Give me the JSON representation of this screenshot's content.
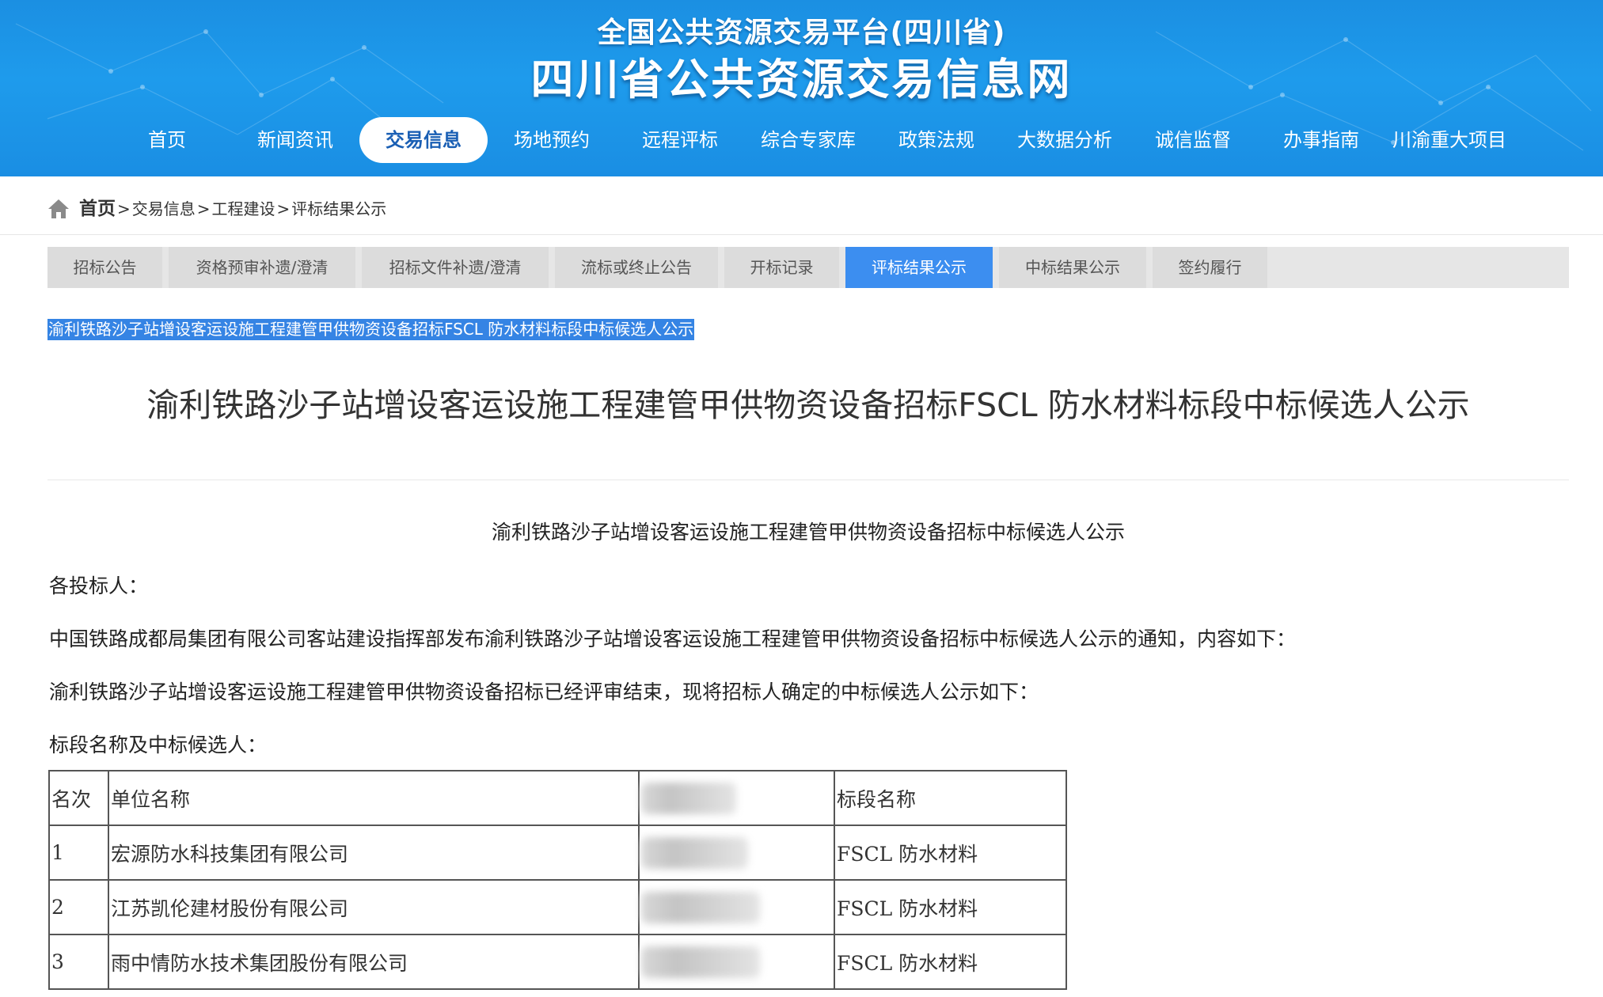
{
  "header": {
    "subtitle": "全国公共资源交易平台(四川省)",
    "title": "四川省公共资源交易信息网"
  },
  "nav": {
    "items": [
      {
        "label": "首页"
      },
      {
        "label": "新闻资讯"
      },
      {
        "label": "交易信息",
        "active": true
      },
      {
        "label": "场地预约"
      },
      {
        "label": "远程评标"
      },
      {
        "label": "综合专家库"
      },
      {
        "label": "政策法规"
      },
      {
        "label": "大数据分析"
      },
      {
        "label": "诚信监督"
      },
      {
        "label": "办事指南"
      },
      {
        "label": "川渝重大项目"
      }
    ]
  },
  "breadcrumb": {
    "home": "首页",
    "items": [
      "交易信息",
      "工程建设",
      "评标结果公示"
    ],
    "separator": ">"
  },
  "subtabs": {
    "items": [
      {
        "label": "招标公告"
      },
      {
        "label": "资格预审补遗/澄清"
      },
      {
        "label": "招标文件补遗/澄清"
      },
      {
        "label": "流标或终止公告"
      },
      {
        "label": "开标记录"
      },
      {
        "label": "评标结果公示",
        "active": true
      },
      {
        "label": "中标结果公示"
      },
      {
        "label": "签约履行"
      }
    ]
  },
  "article": {
    "selected_text": "渝利铁路沙子站增设客运设施工程建管甲供物资设备招标FSCL 防水材料标段中标候选人公示",
    "title": "渝利铁路沙子站增设客运设施工程建管甲供物资设备招标FSCL 防水材料标段中标候选人公示",
    "doc_heading": "渝利铁路沙子站增设客运设施工程建管甲供物资设备招标中标候选人公示",
    "paragraphs": [
      "各投标人：",
      "中国铁路成都局集团有限公司客站建设指挥部发布渝利铁路沙子站增设客运设施工程建管甲供物资设备招标中标候选人公示的通知，内容如下：",
      "渝利铁路沙子站增设客运设施工程建管甲供物资设备招标已经评审结束，现将招标人确定的中标候选人公示如下：",
      "标段名称及中标候选人："
    ]
  },
  "table": {
    "headers": [
      "名次",
      "单位名称",
      "",
      "标段名称"
    ],
    "rows": [
      {
        "rank": "1",
        "company": "宏源防水科技集团有限公司",
        "section": "FSCL  防水材料"
      },
      {
        "rank": "2",
        "company": "江苏凯伦建材股份有限公司",
        "section": "FSCL  防水材料"
      },
      {
        "rank": "3",
        "company": "雨中情防水技术集团股份有限公司",
        "section": "FSCL  防水材料"
      }
    ]
  },
  "colors": {
    "header_blue": "#1e9bec",
    "active_tab_blue": "#3c8ef0",
    "selection_blue": "#3584e4",
    "nav_active_text": "#1a5fb4"
  },
  "icons": {
    "breadcrumb_home": "home-icon"
  }
}
